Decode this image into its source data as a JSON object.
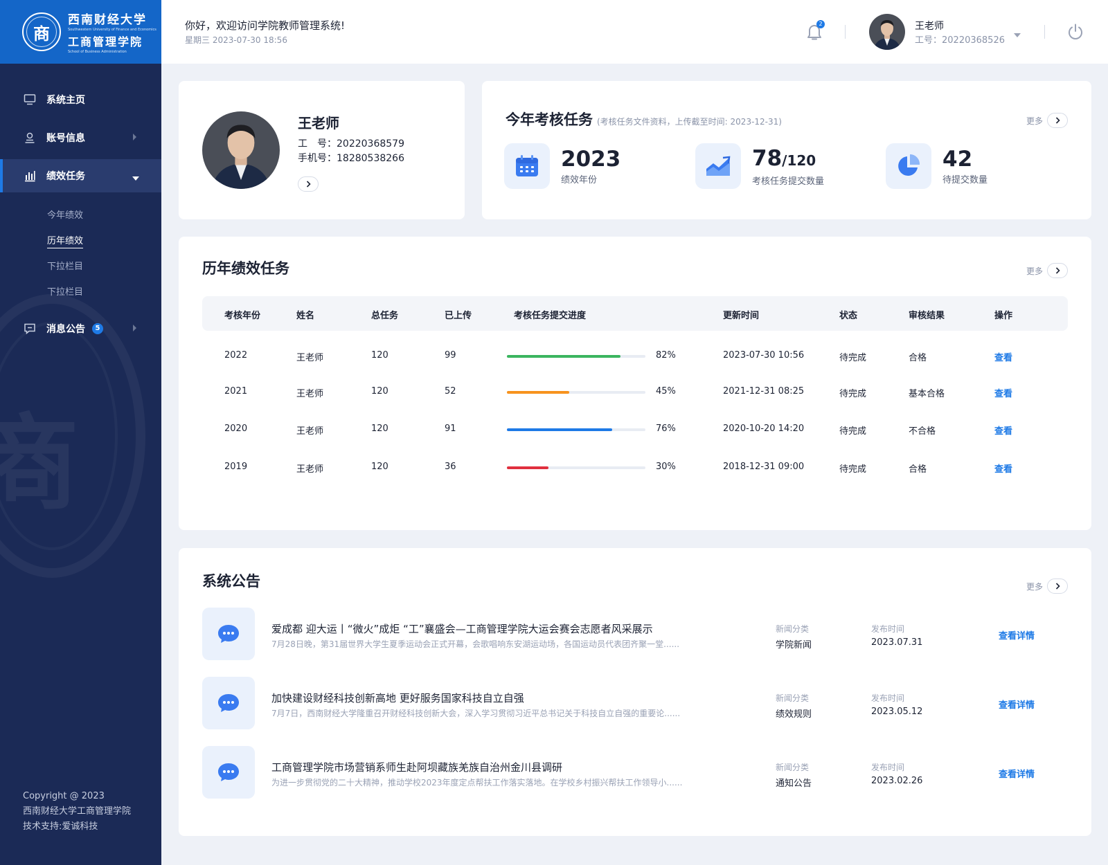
{
  "logo": {
    "seal_char": "商",
    "line1": "西南财经大学",
    "sub": "Southwestern University of Finance and Economics",
    "line2": "工商管理学院",
    "sub2": "School of Business Administration"
  },
  "sidebar": {
    "items": [
      {
        "label": "系统主页",
        "icon": "monitor-icon"
      },
      {
        "label": "账号信息",
        "icon": "user-icon"
      },
      {
        "label": "绩效任务",
        "icon": "bar-chart-icon"
      },
      {
        "label": "消息公告",
        "icon": "message-icon",
        "badge": "5"
      }
    ],
    "subitems": [
      "今年绩效",
      "历年绩效",
      "下拉栏目",
      "下拉栏目"
    ],
    "copyright": [
      "Copyright @ 2023",
      "西南财经大学工商管理学院",
      "技术支持:爱诚科技"
    ]
  },
  "topbar": {
    "welcome": "你好，欢迎访问学院教师管理系统!",
    "datetime": "星期三 2023-07-30 18:56",
    "bell_count": "2",
    "user_name": "王老师",
    "user_id": "工号：20220368526"
  },
  "profile": {
    "name": "王老师",
    "id_label": "工　号：",
    "id": "20220368579",
    "phone_label": "手机号：",
    "phone": "18280538266"
  },
  "tasks": {
    "title": "今年考核任务",
    "note": "(考核任务文件资料，上传截至时间: 2023-12-31)",
    "more": "更多",
    "stats": [
      {
        "value": "2023",
        "suffix": "",
        "label": "绩效年份",
        "icon": "calendar-icon"
      },
      {
        "value": "78",
        "suffix": "/120",
        "label": "考核任务提交数量",
        "icon": "trend-chart-icon"
      },
      {
        "value": "42",
        "suffix": "",
        "label": "待提交数量",
        "icon": "pie-chart-icon"
      }
    ]
  },
  "history": {
    "title": "历年绩效任务",
    "more": "更多",
    "columns": [
      "考核年份",
      "姓名",
      "总任务",
      "已上传",
      "考核任务提交进度",
      "更新时间",
      "状态",
      "审核结果",
      "操作"
    ],
    "rows": [
      {
        "year": "2022",
        "name": "王老师",
        "total": "120",
        "uploaded": "99",
        "progress": 82,
        "progress_label": "82%",
        "color": "#3bb55f",
        "updated": "2023-07-30 10:56",
        "status": "待完成",
        "result": "合格",
        "action": "查看"
      },
      {
        "year": "2021",
        "name": "王老师",
        "total": "120",
        "uploaded": "52",
        "progress": 45,
        "progress_label": "45%",
        "color": "#f7931e",
        "updated": "2021-12-31 08:25",
        "status": "待完成",
        "result": "基本合格",
        "action": "查看"
      },
      {
        "year": "2020",
        "name": "王老师",
        "total": "120",
        "uploaded": "91",
        "progress": 76,
        "progress_label": "76%",
        "color": "#1e7ae6",
        "updated": "2020-10-20 14:20",
        "status": "待完成",
        "result": "不合格",
        "action": "查看"
      },
      {
        "year": "2019",
        "name": "王老师",
        "total": "120",
        "uploaded": "36",
        "progress": 30,
        "progress_label": "30%",
        "color": "#e0303e",
        "updated": "2018-12-31 09:00",
        "status": "待完成",
        "result": "合格",
        "action": "查看"
      }
    ]
  },
  "notices": {
    "title": "系统公告",
    "more": "更多",
    "category_label": "新闻分类",
    "date_label": "发布时间",
    "link": "查看详情",
    "items": [
      {
        "title": "爱成都 迎大运丨“微火”成炬 “工”襄盛会—工商管理学院大运会赛会志愿者风采展示",
        "desc": "7月28日晚，第31届世界大学生夏季运动会正式开幕，会歌唱响东安湖运动场，各国运动员代表团齐聚一堂......",
        "category": "学院新闻",
        "date": "2023.07.31"
      },
      {
        "title": "加快建设财经科技创新高地 更好服务国家科技自立自强",
        "desc": "7月7日，西南财经大学隆重召开财经科技创新大会，深入学习贯彻习近平总书记关于科技自立自强的重要论......",
        "category": "绩效规则",
        "date": "2023.05.12"
      },
      {
        "title": "工商管理学院市场营销系师生赴阿坝藏族羌族自治州金川县调研",
        "desc": "为进一步贯彻党的二十大精神，推动学校2023年度定点帮扶工作落实落地。在学校乡村振兴帮扶工作领导小......",
        "category": "通知公告",
        "date": "2023.02.26"
      }
    ]
  }
}
